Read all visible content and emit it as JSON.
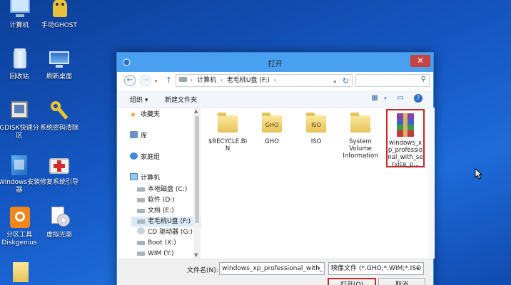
{
  "desktop": {
    "icons": [
      {
        "label": "计算机",
        "icon": "computer-icon"
      },
      {
        "label": "手动GHOST",
        "icon": "ghost-icon"
      },
      {
        "label": "回收站",
        "icon": "recycle-bin-icon"
      },
      {
        "label": "刷新桌面",
        "icon": "refresh-desktop-icon"
      },
      {
        "label": "GDISK快速分区",
        "icon": "gdisk-icon"
      },
      {
        "label": "系统密码清除",
        "icon": "key-icon"
      },
      {
        "label": "Windows安装器",
        "icon": "windows-installer-icon"
      },
      {
        "label": "修复系统引导",
        "icon": "repair-kit-icon"
      },
      {
        "label": "分区工具Diskgenius",
        "icon": "diskgenius-icon"
      },
      {
        "label": "虚拟光驱",
        "icon": "virtual-drive-icon"
      }
    ]
  },
  "dialog": {
    "title": "打开",
    "address": {
      "crumbs": [
        "计算机",
        "老毛桃U盘 (F:)"
      ]
    },
    "toolbar": {
      "organize": "组织 ▾",
      "new_folder": "新建文件夹"
    },
    "nav": {
      "favorites": "收藏夹",
      "libraries": "库",
      "homegroup": "家庭组",
      "computer": "计算机",
      "drives": [
        {
          "label": "本地磁盘 (C:)",
          "selected": false
        },
        {
          "label": "软件 (D:)",
          "selected": false
        },
        {
          "label": "文档 (E:)",
          "selected": false
        },
        {
          "label": "老毛桃U盘 (F:)",
          "selected": true
        },
        {
          "label": "CD 驱动器 (G:)",
          "selected": false
        },
        {
          "label": "Boot (X:)",
          "selected": false
        },
        {
          "label": "WIM (Y:)",
          "selected": false
        }
      ]
    },
    "files": [
      {
        "name": "$RECYCLE.BIN",
        "kind": "folder",
        "tag": ""
      },
      {
        "name": "GHO",
        "kind": "folder",
        "tag": "GHO"
      },
      {
        "name": "ISO",
        "kind": "folder",
        "tag": "ISO"
      },
      {
        "name": "System Volume Information",
        "kind": "folder",
        "tag": ""
      },
      {
        "name": "windows_xp_professional_with_service_p...",
        "kind": "rar",
        "tag": ""
      }
    ],
    "filename_label": "文件名(N):",
    "filename_value": "windows_xp_professional_with_",
    "filetype_value": "映像文件 (*.GHO;*.WIM;*.ISO",
    "open_label": "打开(O)",
    "cancel_label": "取消",
    "close_glyph": "✕"
  },
  "colors": {
    "titlebar": "#49a0f0",
    "highlight": "#c4282c",
    "desktop": "#1558c4"
  }
}
